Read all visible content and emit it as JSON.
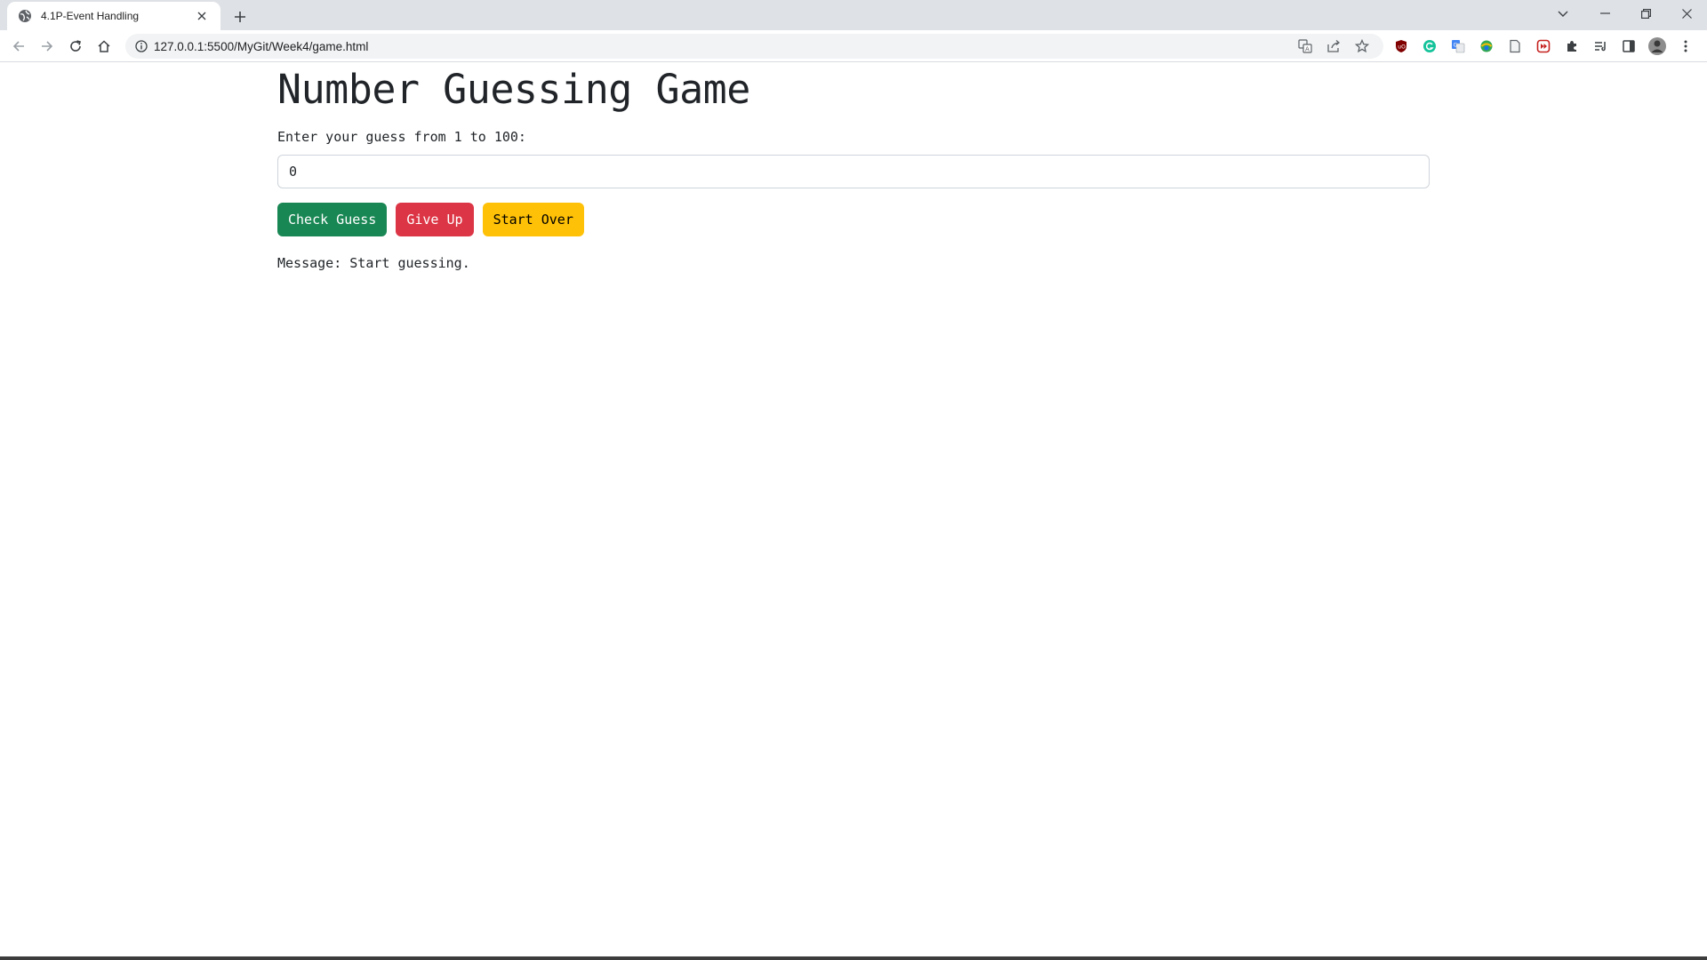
{
  "browser": {
    "tab_title": "4.1P-Event Handling",
    "url": "127.0.0.1:5500/MyGit/Week4/game.html",
    "icons": {
      "favicon": "globe-icon",
      "close": "close-icon",
      "new_tab": "plus-icon",
      "back": "arrow-left-icon",
      "forward": "arrow-right-icon",
      "reload": "reload-icon",
      "home": "home-icon",
      "info": "info-icon",
      "translate": "translate-icon",
      "share": "share-icon",
      "bookmark": "star-icon"
    },
    "extensions": [
      "ublock-icon",
      "grammarly-icon",
      "google-translate-icon",
      "extension-globe-icon",
      "document-icon",
      "media-icon",
      "puzzle-icon",
      "reading-list-icon",
      "side-panel-icon",
      "profile-avatar",
      "more-vert-icon"
    ]
  },
  "page": {
    "title": "Number Guessing Game",
    "guess_label": "Enter your guess from 1 to 100:",
    "guess_value": "0",
    "buttons": {
      "check": "Check Guess",
      "give_up": "Give Up",
      "start_over": "Start Over"
    },
    "message": "Message: Start guessing."
  },
  "colors": {
    "check_bg": "#198754",
    "give_up_bg": "#dc3545",
    "start_over_bg": "#ffc107"
  }
}
